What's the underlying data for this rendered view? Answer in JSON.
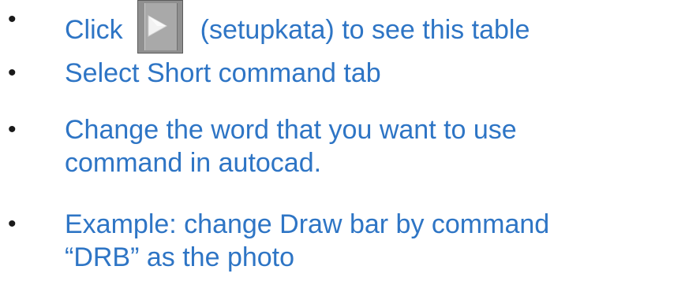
{
  "colors": {
    "text": "#2e75c5",
    "bullet": "#1a1a1a"
  },
  "bullets": [
    {
      "before_icon": "Click",
      "icon": "play-icon",
      "after_icon": "(setupkata) to see this table"
    },
    {
      "text": "Select Short command tab"
    },
    {
      "lines": [
        "Change the word that you want to use",
        "command in autocad."
      ]
    },
    {
      "lines": [
        "Example: change Draw bar by command",
        "“DRB” as the photo"
      ]
    }
  ],
  "bullet_glyph": "•"
}
